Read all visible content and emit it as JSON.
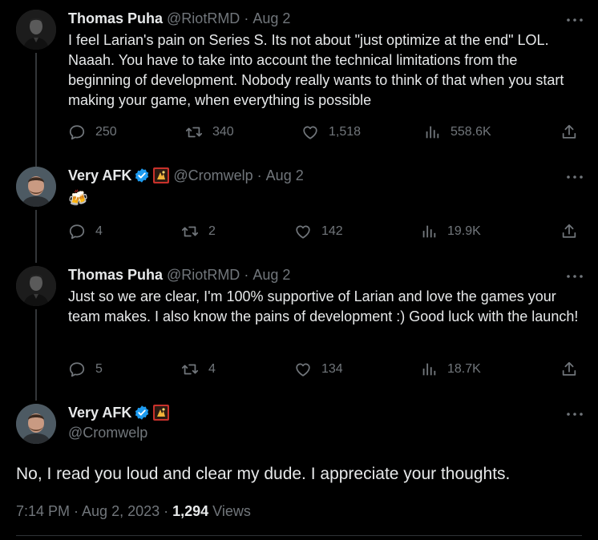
{
  "tweets": [
    {
      "name": "Thomas Puha",
      "handle": "@RiotRMD",
      "dot": "·",
      "date": "Aug 2",
      "text": "I feel Larian's pain on Series S. Its not about \"just optimize at the end\" LOL. Naaah. You have to take into account the technical limitations from the beginning of development. Nobody really wants to think of that when you start making your game, when everything is possible",
      "replies": "250",
      "retweets": "340",
      "likes": "1,518",
      "views": "558.6K"
    },
    {
      "name": "Very AFK",
      "handle": "@Cromwelp",
      "dot": "·",
      "date": "Aug 2",
      "text": "🍻",
      "replies": "4",
      "retweets": "2",
      "likes": "142",
      "views": "19.9K"
    },
    {
      "name": "Thomas Puha",
      "handle": "@RiotRMD",
      "dot": "·",
      "date": "Aug 2",
      "text": "Just so we are clear, I'm 100% supportive of Larian and love the games your team makes. I also know the pains of development :) Good luck with the launch!",
      "replies": "5",
      "retweets": "4",
      "likes": "134",
      "views": "18.7K"
    }
  ],
  "main_tweet": {
    "name": "Very AFK",
    "handle": "@Cromwelp",
    "text": "No, I read you loud and clear my dude. I appreciate your thoughts.",
    "timestamp": "7:14 PM · Aug 2, 2023 · ",
    "views_count": "1,294",
    "views_label": " Views"
  },
  "colors": {
    "background": "#000000",
    "text": "#e7e9ea",
    "muted": "#71767b",
    "verified": "#1d9bf0"
  },
  "icons": [
    "more-icon",
    "reply-icon",
    "retweet-icon",
    "like-icon",
    "views-icon",
    "share-icon",
    "verified-badge-icon",
    "affiliate-flair-icon"
  ]
}
